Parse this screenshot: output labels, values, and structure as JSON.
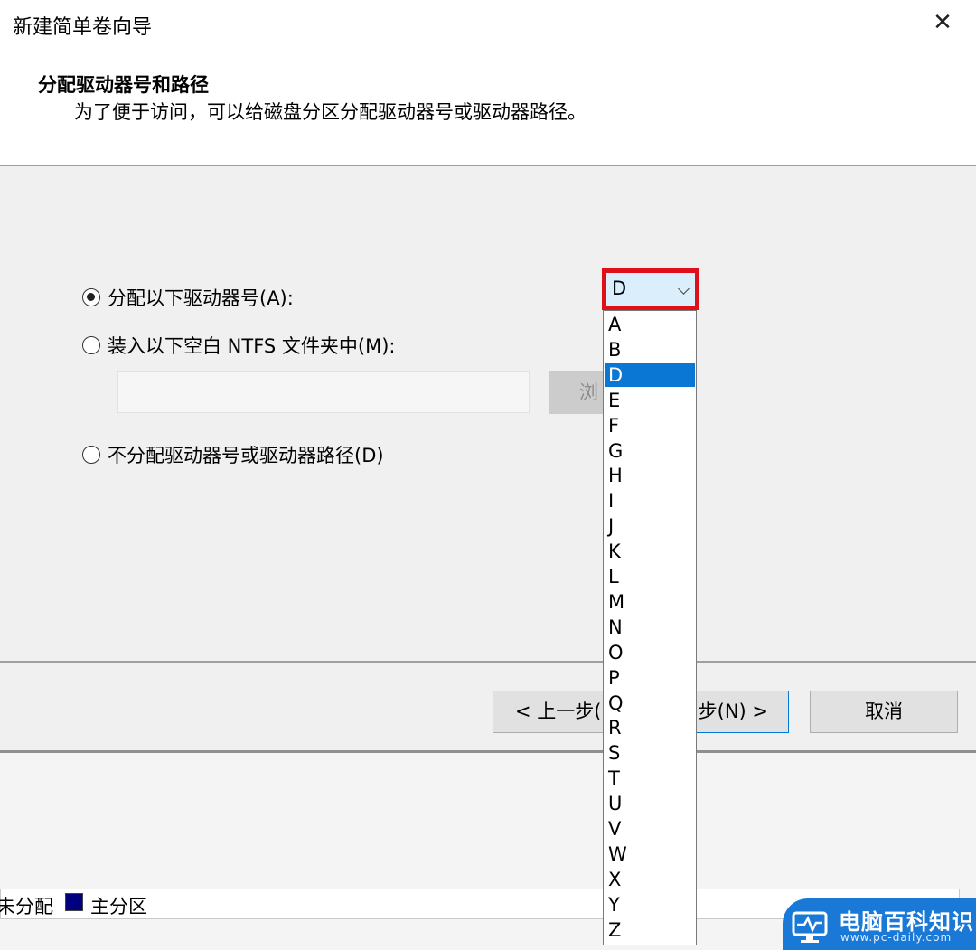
{
  "window": {
    "title": "新建简单卷向导",
    "close_glyph": "✕"
  },
  "header": {
    "title": "分配驱动器号和路径",
    "description": "为了便于访问，可以给磁盘分区分配驱动器号或驱动器路径。"
  },
  "options": {
    "assign_letter": {
      "label": "分配以下驱动器号(A):",
      "checked": true
    },
    "mount_folder": {
      "label": "装入以下空白 NTFS 文件夹中(M):",
      "checked": false
    },
    "no_assign": {
      "label": "不分配驱动器号或驱动器路径(D)",
      "checked": false
    }
  },
  "mount_path": {
    "value": "",
    "browse_label": "浏"
  },
  "drive_letter": {
    "selected": "D",
    "options": [
      "A",
      "B",
      "D",
      "E",
      "F",
      "G",
      "H",
      "I",
      "J",
      "K",
      "L",
      "M",
      "N",
      "O",
      "P",
      "Q",
      "R",
      "S",
      "T",
      "U",
      "V",
      "W",
      "X",
      "Y",
      "Z"
    ]
  },
  "buttons": {
    "back": "< 上一步(",
    "next": "步(N) >",
    "cancel": "取消"
  },
  "legend": {
    "unallocated": "未分配",
    "primary": "主分区",
    "primary_color": "#00007f"
  },
  "watermark": {
    "text": "电脑百科知识",
    "url": "www.pc-daily.com"
  },
  "colors": {
    "highlight_border": "#e0101b",
    "selection": "#0a77d5",
    "accent": "#0078d7"
  }
}
